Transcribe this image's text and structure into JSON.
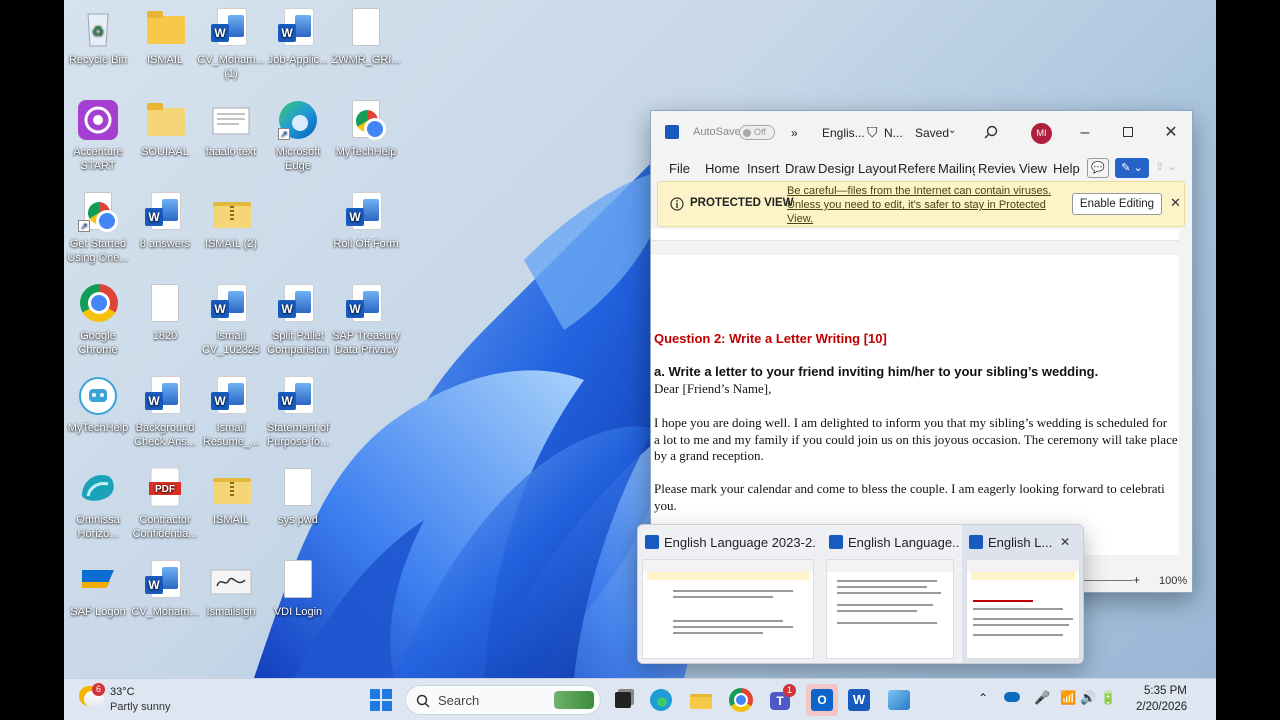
{
  "desktop_icons": [
    {
      "label": "Recycle Bin"
    },
    {
      "label": "ISMAIL"
    },
    {
      "label": "CV_Moham... (1)"
    },
    {
      "label": "Job-Applic..."
    },
    {
      "label": "ZWMR_GRI..."
    },
    {
      "label": "Accenture START"
    },
    {
      "label": "SOUIAAL"
    },
    {
      "label": "faaalo text"
    },
    {
      "label": "Microsoft Edge"
    },
    {
      "label": "MyTechHelp"
    },
    {
      "label": "Get Started Using One..."
    },
    {
      "label": "8 answers"
    },
    {
      "label": "ISMAIL (2)"
    },
    {
      "label": "Roll Off Form"
    },
    {
      "label": "Google Chrome"
    },
    {
      "label": "1820"
    },
    {
      "label": "Ismail CV_102325"
    },
    {
      "label": "Split Pallet Comparision"
    },
    {
      "label": "SAP Treasury Data Privacy"
    },
    {
      "label": "MyTechHelp"
    },
    {
      "label": "Background Check Ans..."
    },
    {
      "label": "Ismail Resume_..."
    },
    {
      "label": "Statement of Purpose fo..."
    },
    {
      "label": "Omnissa Horizo..."
    },
    {
      "label": "Contractor Confidentia..."
    },
    {
      "label": "ISMAIL"
    },
    {
      "label": "sys pwd"
    },
    {
      "label": "SAP Logon"
    },
    {
      "label": "CV_Moham..."
    },
    {
      "label": "Ismailsign"
    },
    {
      "label": "VDI Login"
    }
  ],
  "word": {
    "autosave": "AutoSave",
    "autosave_state": "Off",
    "title": "Englis...",
    "sensitivity": "N...",
    "saved": "Saved",
    "avatar": "MI",
    "menu": [
      "File",
      "Home",
      "Insert",
      "Draw",
      "Design",
      "Layout",
      "References",
      "Mailings",
      "Review",
      "View",
      "Help"
    ],
    "protected_label": "PROTECTED VIEW",
    "protected_msg": "Be careful—files from the Internet can contain viruses. Unless you need to edit, it's safer to stay in Protected View.",
    "enable_editing": "Enable Editing",
    "doc_lines": [
      "Question 2: Write a Letter Writing [10]",
      "a. Write a letter to your friend inviting him/her to your sibling’s wedding.",
      "Dear [Friend’s Name],",
      "I hope you are doing well. I am delighted to inform you that my sibling’s wedding is scheduled for",
      "a lot to me and my family if you could join us on this joyous occasion. The ceremony will take place",
      "by a grand reception.",
      "Please mark your calendar and come to bless the couple. I am eagerly looking forward to celebrati",
      "you."
    ],
    "zoom": "100%"
  },
  "previews": [
    {
      "title": "English Language 2023-2..."
    },
    {
      "title": "English Language..."
    },
    {
      "title": "English L..."
    }
  ],
  "taskbar": {
    "weather_temp": "33°C",
    "weather_desc": "Partly sunny",
    "weather_badge": "6",
    "search_placeholder": "Search",
    "teams_badge": "1",
    "time": "5:35 PM",
    "date": "2/20/2026"
  },
  "colors": {
    "accent": "#185abd",
    "question_red": "#c00000",
    "protected_bg": "#fcf4c8"
  }
}
